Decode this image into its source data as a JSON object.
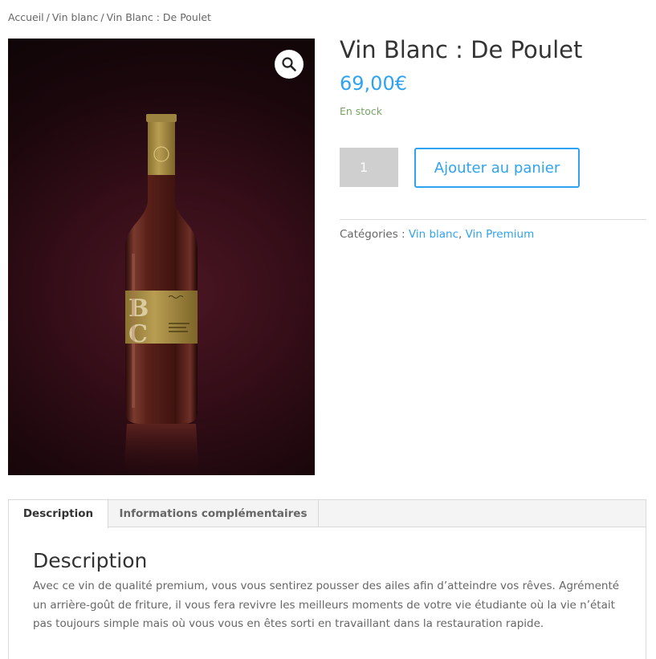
{
  "breadcrumb": {
    "items": [
      "Accueil",
      "Vin blanc",
      "Vin Blanc : De Poulet"
    ],
    "separator": "/"
  },
  "gallery": {
    "zoom_icon": "magnifier-icon",
    "image_alt": "wine-bottle",
    "label_letters": "BC"
  },
  "product": {
    "title": "Vin Blanc : De Poulet",
    "price": "69,00€",
    "stock": "En stock",
    "quantity": "1",
    "add_to_cart_label": "Ajouter au panier",
    "categories_label": "Catégories :",
    "categories": [
      "Vin blanc",
      "Vin Premium"
    ],
    "category_separator": ","
  },
  "tabs": {
    "items": [
      "Description",
      "Informations complémentaires"
    ],
    "active": "Description",
    "panel_title": "Description",
    "panel_text": "Avec ce vin de qualité premium, vous vous sentirez pousser des ailes afin d’atteindre vos rêves. Agrémenté un arrière-goût de friture, il vous fera revivre les meilleurs moments de votre vie étudiante où la vie n’était pas toujours simple mais où vous vous en êtes sorti en travaillant dans la restauration rapide."
  },
  "colors": {
    "accent": "#2ea3f2",
    "stock": "#77a464",
    "heading": "#333333",
    "text": "#666666"
  }
}
